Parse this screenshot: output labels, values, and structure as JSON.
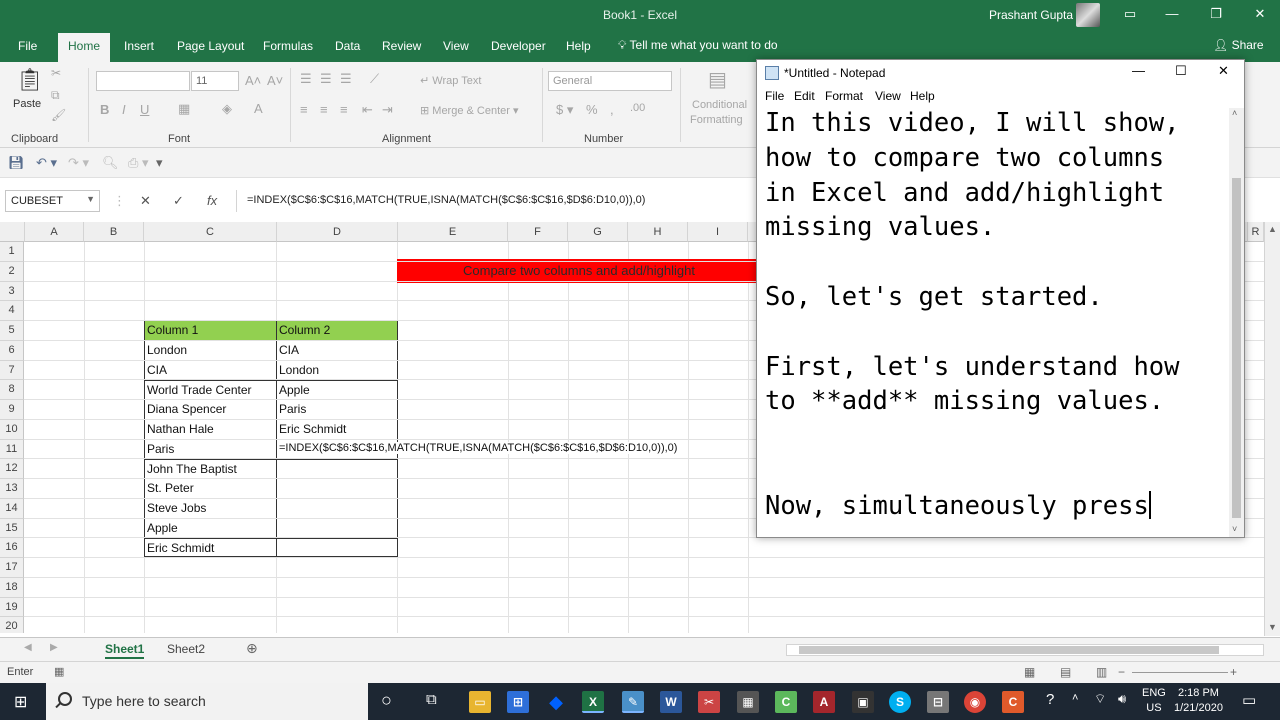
{
  "window": {
    "title": "Book1  -  Excel",
    "user": "Prashant Gupta"
  },
  "ribbon_tabs": [
    "File",
    "Home",
    "Insert",
    "Page Layout",
    "Formulas",
    "Data",
    "Review",
    "View",
    "Developer",
    "Help"
  ],
  "active_tab": "Home",
  "tell_me": "Tell me what you want to do",
  "share": "Share",
  "ribbon": {
    "paste": "Paste",
    "font_size": "11",
    "wrap_text": "Wrap Text",
    "merge_center": "Merge & Center",
    "number_format": "General",
    "conditional_formatting_1": "Conditional",
    "conditional_formatting_2": "Formatting",
    "groups": {
      "clipboard": "Clipboard",
      "font": "Font",
      "alignment": "Alignment",
      "number": "Number"
    }
  },
  "formula_bar": {
    "name_box": "CUBESET",
    "formula": "=INDEX($C$6:$C$16,MATCH(TRUE,ISNA(MATCH($C$6:$C$16,$D$6:D10,0)),0)"
  },
  "grid": {
    "columns": [
      "A",
      "B",
      "C",
      "D",
      "E",
      "F",
      "G",
      "H",
      "I",
      "R"
    ],
    "rows": [
      "1",
      "2",
      "3",
      "4",
      "5",
      "6",
      "7",
      "8",
      "9",
      "10",
      "11",
      "12",
      "13",
      "14",
      "15",
      "16",
      "17",
      "18",
      "19",
      "20"
    ],
    "banner": "Compare two columns and add/highlight",
    "header_c": "Column 1",
    "header_d": "Column 2",
    "column1": [
      "London",
      "CIA",
      "World Trade Center",
      "Diana Spencer",
      "Nathan Hale",
      "Paris",
      "John The Baptist",
      "St. Peter",
      "Steve Jobs",
      "Apple",
      "Eric Schmidt"
    ],
    "column2": [
      "CIA",
      "London",
      "Apple",
      "Paris",
      "Eric Schmidt"
    ],
    "editing_formula": "=INDEX($C$6:$C$16,MATCH(TRUE,ISNA(MATCH($C$6:$C$16,$D$6:D10,0)),0)"
  },
  "sheets": [
    "Sheet1",
    "Sheet2"
  ],
  "active_sheet": "Sheet1",
  "status": {
    "mode": "Enter"
  },
  "notepad": {
    "title": "*Untitled - Notepad",
    "menu": [
      "File",
      "Edit",
      "Format",
      "View",
      "Help"
    ],
    "text": "In this video, I will show,\nhow to compare two columns\nin Excel and add/highlight\nmissing values.\n\nSo, let's get started.\n\nFirst, let's understand how\nto **add** missing values.\n\n\nNow, simultaneously press"
  },
  "taskbar": {
    "search_placeholder": "Type here to search",
    "lang_1": "ENG",
    "lang_2": "US",
    "time": "2:18 PM",
    "date": "1/21/2020"
  },
  "colors": {
    "excel_green": "#217346",
    "header_fill": "#92d050",
    "banner_fill": "#ff0000"
  }
}
